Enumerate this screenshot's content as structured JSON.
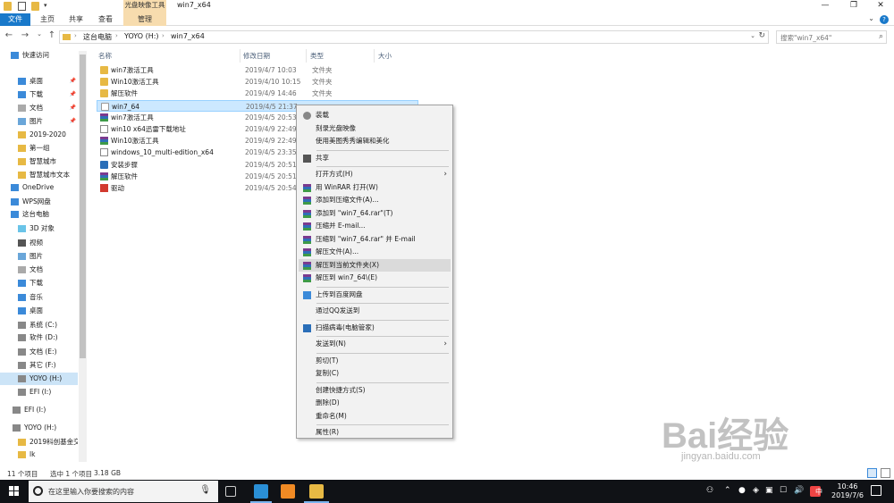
{
  "window": {
    "title": "win7_x64",
    "quick_access_pin": "▾",
    "tools_label": "光盘映像工具",
    "controls": [
      "—",
      "❐",
      "✕"
    ]
  },
  "ribbon": {
    "tabs": [
      "文件",
      "主页",
      "共享",
      "查看",
      "管理"
    ],
    "help": "?"
  },
  "address": {
    "crumbs": [
      "这台电脑",
      "YOYO (H:)",
      "win7_x64"
    ],
    "search_placeholder": "搜索\"win7_x64\""
  },
  "nav": {
    "items": [
      {
        "label": "快速访问",
        "icon": "star-icon"
      },
      {
        "label": "桌面",
        "icon": "desktop-icon",
        "pinned": true
      },
      {
        "label": "下载",
        "icon": "download-icon",
        "pinned": true
      },
      {
        "label": "文档",
        "icon": "document-icon",
        "pinned": true
      },
      {
        "label": "图片",
        "icon": "picture-icon",
        "pinned": true
      },
      {
        "label": "2019-2020",
        "icon": "folder-icon"
      },
      {
        "label": "第一组",
        "icon": "folder-icon"
      },
      {
        "label": "智慧城市",
        "icon": "folder-icon"
      },
      {
        "label": "智慧城市文本",
        "icon": "folder-icon"
      },
      {
        "label": "OneDrive",
        "icon": "cloud-icon"
      },
      {
        "label": "WPS网盘",
        "icon": "wps-cloud-icon"
      },
      {
        "label": "这台电脑",
        "icon": "computer-icon"
      },
      {
        "label": "3D 对象",
        "icon": "3d-icon"
      },
      {
        "label": "视频",
        "icon": "video-icon"
      },
      {
        "label": "图片",
        "icon": "picture-icon"
      },
      {
        "label": "文档",
        "icon": "document-icon"
      },
      {
        "label": "下载",
        "icon": "download-icon"
      },
      {
        "label": "音乐",
        "icon": "music-icon"
      },
      {
        "label": "桌面",
        "icon": "desktop-icon"
      },
      {
        "label": "系统 (C:)",
        "icon": "drive-icon"
      },
      {
        "label": "软件 (D:)",
        "icon": "drive-icon"
      },
      {
        "label": "文档 (E:)",
        "icon": "drive-icon"
      },
      {
        "label": "其它 (F:)",
        "icon": "drive-icon"
      },
      {
        "label": "YOYO (H:)",
        "icon": "drive-icon",
        "selected": true
      },
      {
        "label": "EFI (I:)",
        "icon": "drive-icon"
      },
      {
        "label": "EFI (I:)",
        "icon": "drive-icon"
      },
      {
        "label": "YOYO (H:)",
        "icon": "drive-icon"
      },
      {
        "label": "2019科创基金交",
        "icon": "folder-icon"
      },
      {
        "label": "lk",
        "icon": "folder-icon"
      }
    ]
  },
  "columns": {
    "name": "名称",
    "date": "修改日期",
    "type": "类型",
    "size": "大小"
  },
  "files": [
    {
      "name": "win7激活工具",
      "date": "2019/4/7 10:03",
      "type": "文件夹",
      "icon": "folder"
    },
    {
      "name": "Win10激活工具",
      "date": "2019/4/10 10:15",
      "type": "文件夹",
      "icon": "folder"
    },
    {
      "name": "解压软件",
      "date": "2019/4/9 14:46",
      "type": "文件夹",
      "icon": "folder"
    },
    {
      "name": "win7_64",
      "date": "2019/4/5 21:37",
      "type": "",
      "icon": "iso",
      "selected": true
    },
    {
      "name": "win7激活工具",
      "date": "2019/4/5 20:53",
      "type": "",
      "icon": "rar"
    },
    {
      "name": "win10 x64迅雷下载地址",
      "date": "2019/4/9 22:49",
      "type": "",
      "icon": "doc"
    },
    {
      "name": "Win10激活工具",
      "date": "2019/4/9 22:49",
      "type": "",
      "icon": "rar"
    },
    {
      "name": "windows_10_multi-edition_x64",
      "date": "2019/4/5 23:35",
      "type": "",
      "icon": "doc"
    },
    {
      "name": "安装步骤",
      "date": "2019/4/5 20:51",
      "type": "",
      "icon": "exe"
    },
    {
      "name": "解压软件",
      "date": "2019/4/5 20:51",
      "type": "",
      "icon": "rar"
    },
    {
      "name": "驱动",
      "date": "2019/4/5 20:54",
      "type": "",
      "icon": "red"
    }
  ],
  "context_menu": {
    "items": [
      {
        "label": "装载",
        "icon": "mount-icon"
      },
      {
        "label": "刻录光盘映像"
      },
      {
        "label": "使用美图秀秀编辑和美化"
      },
      {
        "sep": true
      },
      {
        "label": "共享",
        "icon": "share-icon"
      },
      {
        "sep": true
      },
      {
        "label": "打开方式(H)",
        "submenu": true
      },
      {
        "label": "用 WinRAR 打开(W)",
        "icon": "winrar-icon"
      },
      {
        "label": "添加到压缩文件(A)...",
        "icon": "winrar-icon"
      },
      {
        "label": "添加到 \"win7_64.rar\"(T)",
        "icon": "winrar-icon"
      },
      {
        "label": "压缩并 E-mail...",
        "icon": "winrar-icon"
      },
      {
        "label": "压缩到 \"win7_64.rar\" 并 E-mail",
        "icon": "winrar-icon"
      },
      {
        "label": "解压文件(A)...",
        "icon": "winrar-icon"
      },
      {
        "label": "解压到当前文件夹(X)",
        "icon": "winrar-icon",
        "highlight": true
      },
      {
        "label": "解压到 win7_64\\(E)",
        "icon": "winrar-icon"
      },
      {
        "sep": true
      },
      {
        "label": "上传到百度网盘",
        "icon": "baidu-cloud-icon"
      },
      {
        "sep": true
      },
      {
        "label": "通过QQ发送到"
      },
      {
        "sep": true
      },
      {
        "label": "扫描病毒(电脑管家)",
        "icon": "shield-icon"
      },
      {
        "sep": true
      },
      {
        "label": "发送到(N)",
        "submenu": true
      },
      {
        "sep": true
      },
      {
        "label": "剪切(T)"
      },
      {
        "label": "复制(C)"
      },
      {
        "sep": true
      },
      {
        "label": "创建快捷方式(S)"
      },
      {
        "label": "删除(D)"
      },
      {
        "label": "重命名(M)"
      },
      {
        "sep": true
      },
      {
        "label": "属性(R)"
      }
    ]
  },
  "status": {
    "count": "11 个项目",
    "selected": "选中 1 个项目",
    "size": "3.18 GB"
  },
  "taskbar": {
    "search_placeholder": "在这里输入你要搜索的内容",
    "time": "10:46",
    "date": "2019/7/6",
    "ime": "中"
  },
  "watermark": {
    "logo": "Bai经验",
    "url": "jingyan.baidu.com"
  }
}
